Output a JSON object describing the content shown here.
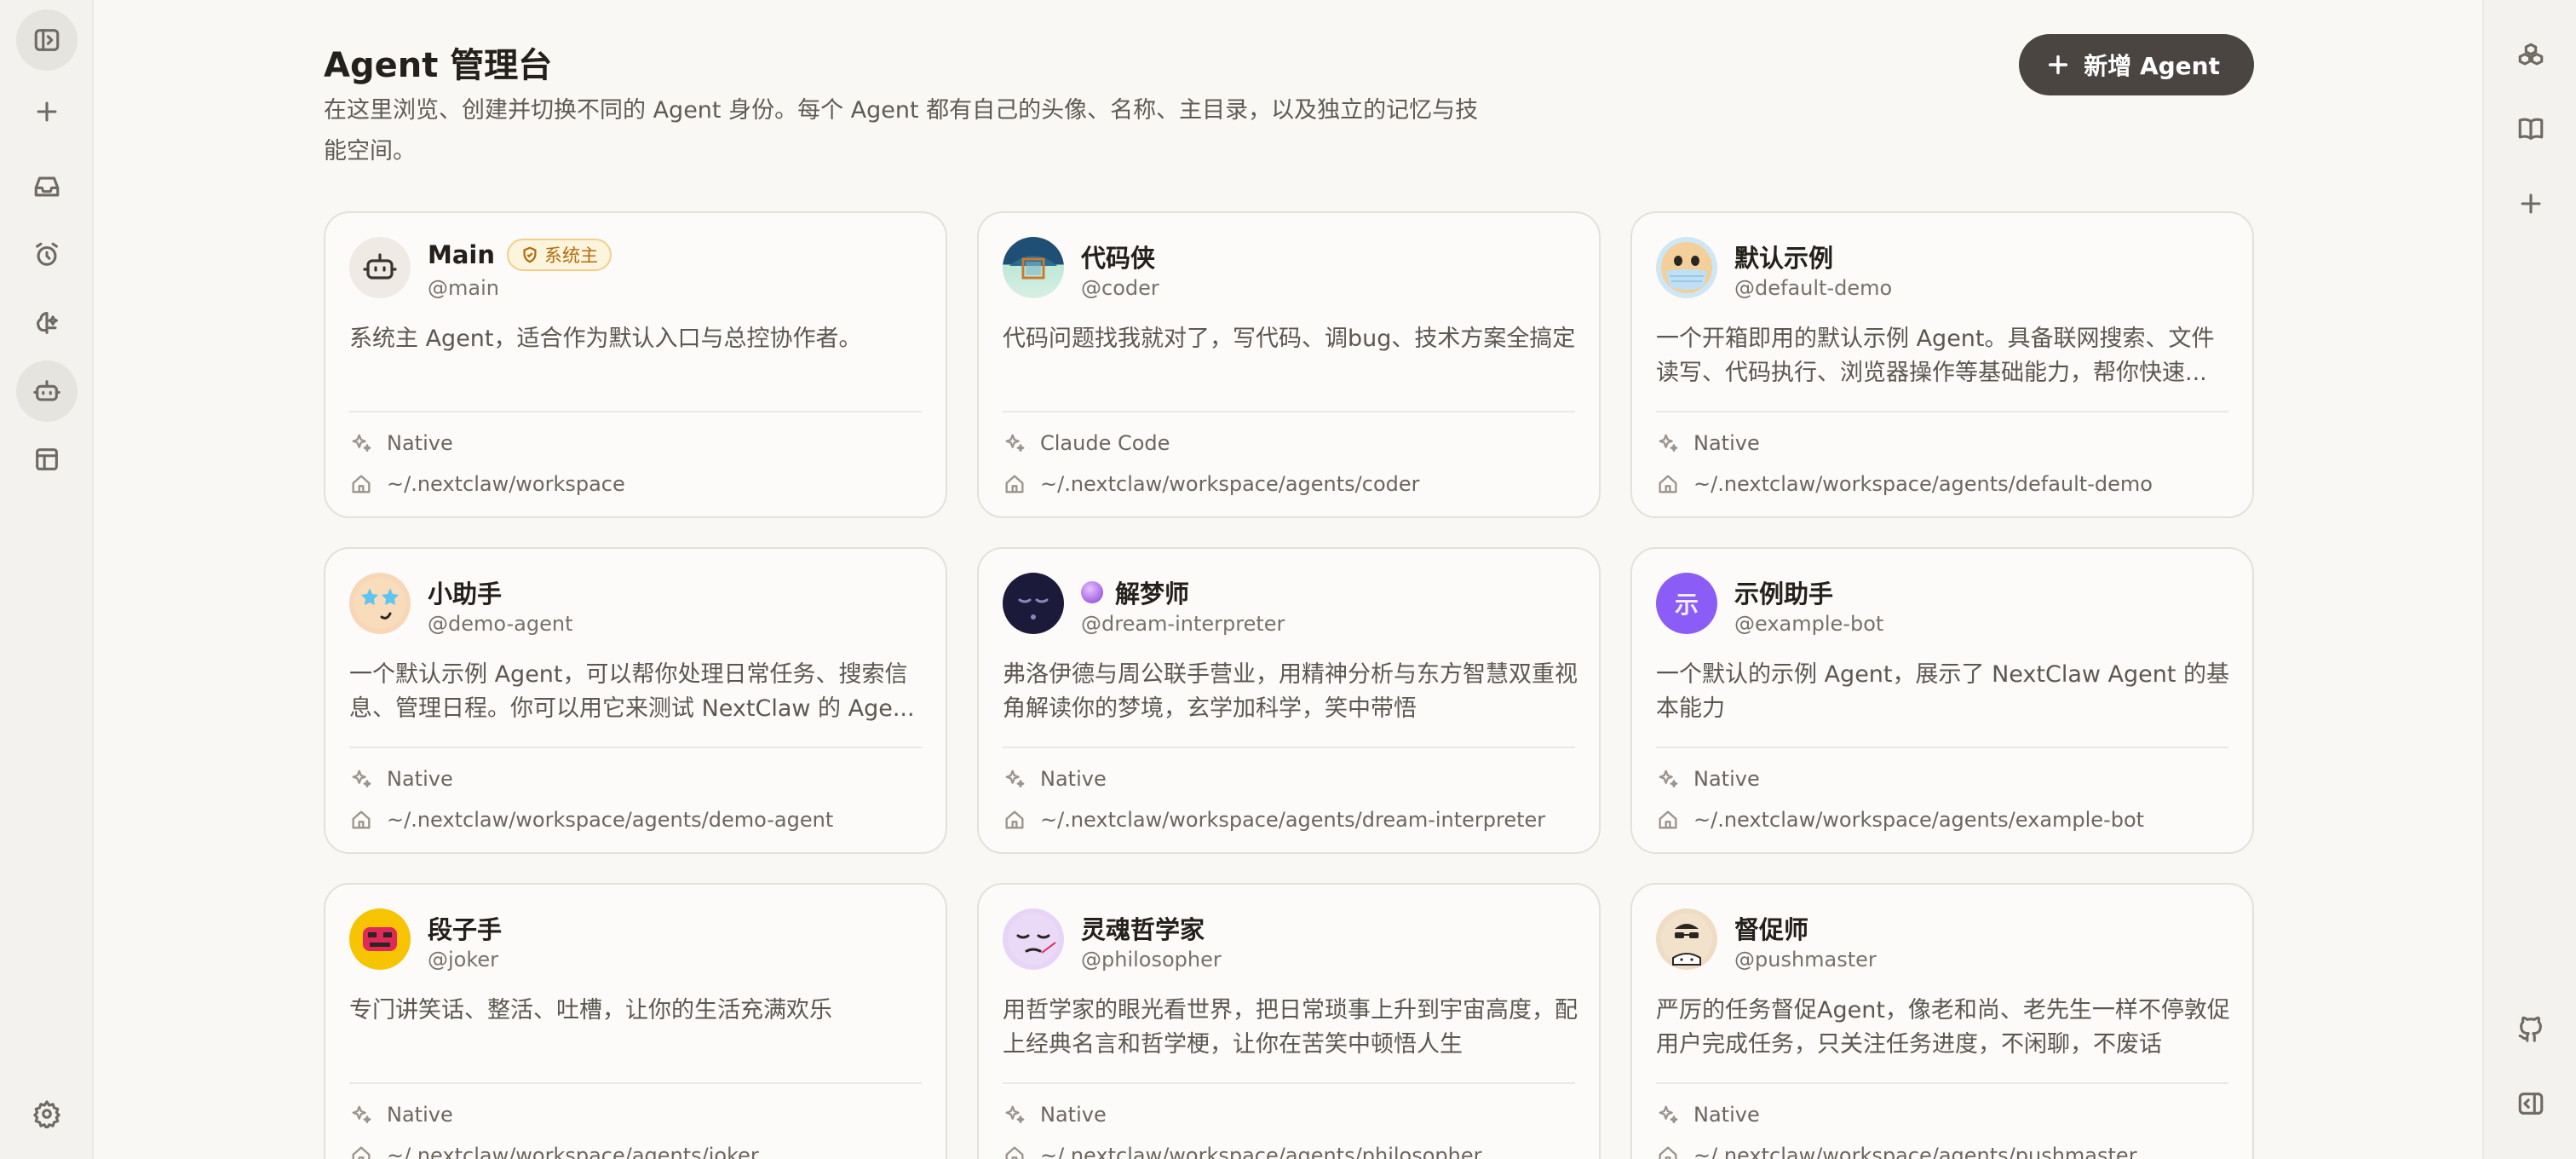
{
  "page": {
    "title": "Agent 管理台",
    "description": "在这里浏览、创建并切换不同的 Agent 身份。每个 Agent 都有自己的头像、名称、主目录，以及独立的记忆与技能空间。",
    "add_button": "新增 Agent"
  },
  "colors": {
    "background": "#f9f8f5",
    "primary_button": "#4a4541",
    "badge_text": "#b06b0a",
    "badge_bg": "#fdf4de"
  },
  "left_rail": [
    {
      "icon": "sidebar-toggle-icon"
    },
    {
      "icon": "plus-icon"
    },
    {
      "icon": "inbox-icon"
    },
    {
      "icon": "alarm-clock-icon"
    },
    {
      "icon": "brain-sparkle-icon"
    },
    {
      "icon": "bot-icon",
      "active": true
    },
    {
      "icon": "layout-icon"
    },
    {
      "icon": "settings-icon"
    }
  ],
  "right_rail": [
    {
      "icon": "boxes-icon"
    },
    {
      "icon": "book-icon"
    },
    {
      "icon": "plus-icon"
    },
    {
      "icon": "github-icon"
    },
    {
      "icon": "panel-right-icon"
    }
  ],
  "agents": [
    {
      "name": "Main",
      "badge": "系统主",
      "handle": "@main",
      "description": "系统主 Agent，适合作为默认入口与总控协作者。",
      "runtime": "Native",
      "home": "~/.nextclaw/workspace",
      "avatar": "bot"
    },
    {
      "name": "代码侠",
      "handle": "@coder",
      "description": "代码问题找我就对了，写代码、调bug、技术方案全搞定",
      "runtime": "Claude Code",
      "home": "~/.nextclaw/workspace/agents/coder",
      "avatar": "coder"
    },
    {
      "name": "默认示例",
      "handle": "@default-demo",
      "description": "一个开箱即用的默认示例 Agent。具备联网搜索、文件读写、代码执行、浏览器操作等基础能力，帮你快速...",
      "runtime": "Native",
      "home": "~/.nextclaw/workspace/agents/default-demo",
      "avatar": "mask"
    },
    {
      "name": "小助手",
      "handle": "@demo-agent",
      "description": "一个默认示例 Agent，可以帮你处理日常任务、搜索信息、管理日程。你可以用它来测试 NextClaw 的 Age...",
      "runtime": "Native",
      "home": "~/.nextclaw/workspace/agents/demo-agent",
      "avatar": "star-eyes"
    },
    {
      "name": "解梦师",
      "handle": "@dream-interpreter",
      "description": "弗洛伊德与周公联手营业，用精神分析与东方智慧双重视角解读你的梦境，玄学加科学，笑中带悟",
      "runtime": "Native",
      "home": "~/.nextclaw/workspace/agents/dream-interpreter",
      "avatar": "dream",
      "emoji": "crystal-ball"
    },
    {
      "name": "示例助手",
      "handle": "@example-bot",
      "description": "一个默认的示例 Agent，展示了 NextClaw Agent 的基本能力",
      "runtime": "Native",
      "home": "~/.nextclaw/workspace/agents/example-bot",
      "avatar": "letter",
      "avatar_text": "示"
    },
    {
      "name": "段子手",
      "handle": "@joker",
      "description": "专门讲笑话、整活、吐槽，让你的生活充满欢乐",
      "runtime": "Native",
      "home": "~/.nextclaw/workspace/agents/joker",
      "avatar": "joker"
    },
    {
      "name": "灵魂哲学家",
      "handle": "@philosopher",
      "description": "用哲学家的眼光看世界，把日常琐事上升到宇宙高度，配上经典名言和哲学梗，让你在苦笑中顿悟人生",
      "runtime": "Native",
      "home": "~/.nextclaw/workspace/agents/philosopher",
      "avatar": "philosopher"
    },
    {
      "name": "督促师",
      "handle": "@pushmaster",
      "description": "严厉的任务督促Agent，像老和尚、老先生一样不停敦促用户完成任务，只关注任务进度，不闲聊，不废话",
      "runtime": "Native",
      "home": "~/.nextclaw/workspace/agents/pushmaster",
      "avatar": "pushmaster"
    }
  ]
}
